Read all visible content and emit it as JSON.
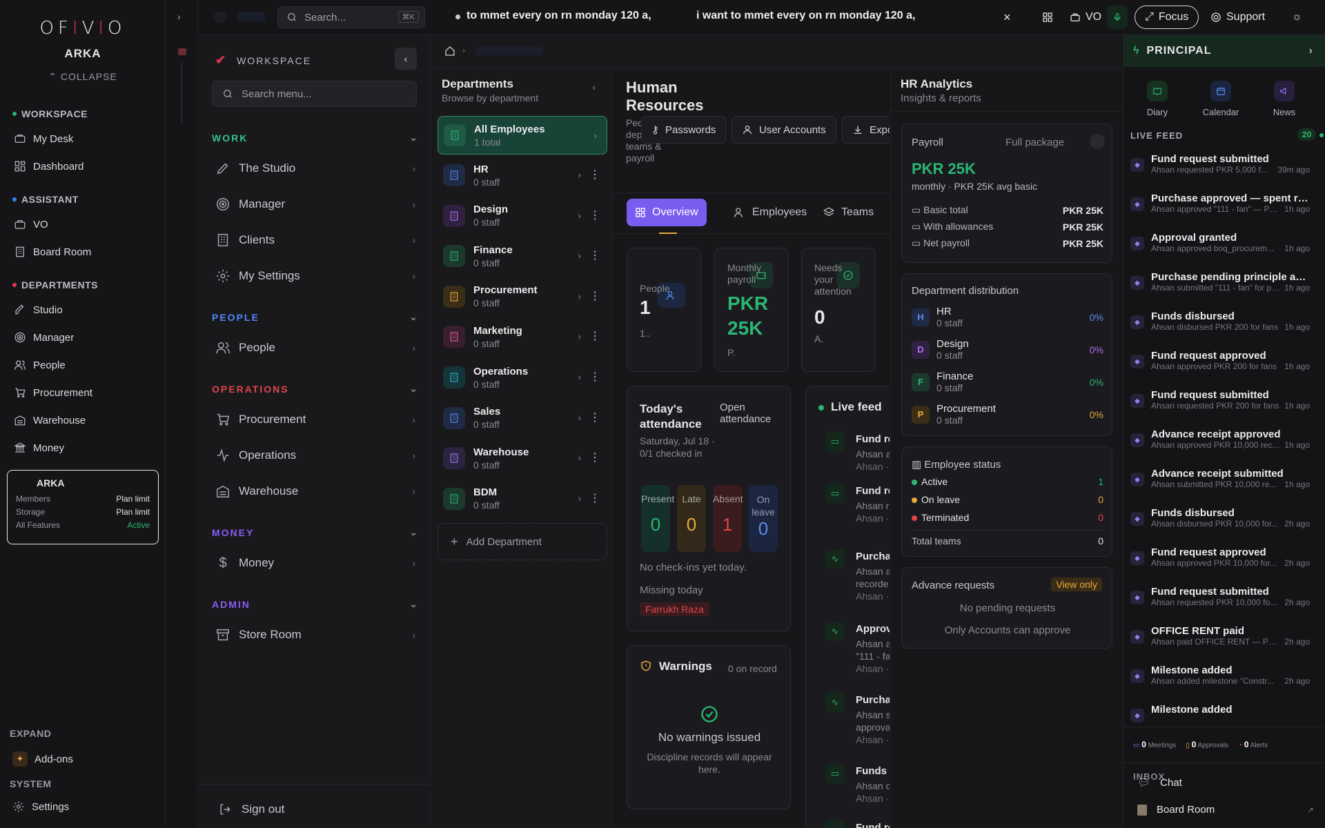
{
  "brand": {
    "logo_text": "OFIVIO",
    "org": "ARKA",
    "collapse_label": "COLLAPSE"
  },
  "leftnav": {
    "sections": [
      {
        "label": "WORKSPACE",
        "color": "#2bb673",
        "items": [
          {
            "label": "My Desk",
            "icon": "desk-icon"
          },
          {
            "label": "Dashboard",
            "icon": "dashboard-icon"
          }
        ]
      },
      {
        "label": "ASSISTANT",
        "color": "#3b82f6",
        "items": [
          {
            "label": "VO",
            "icon": "briefcase-icon"
          },
          {
            "label": "Board Room",
            "icon": "building-icon"
          }
        ]
      },
      {
        "label": "DEPARTMENTS",
        "color": "#e03b4c",
        "items": [
          {
            "label": "Studio",
            "icon": "brush-icon"
          },
          {
            "label": "Manager",
            "icon": "target-icon"
          },
          {
            "label": "People",
            "icon": "people-icon"
          },
          {
            "label": "Procurement",
            "icon": "cart-icon"
          },
          {
            "label": "Warehouse",
            "icon": "warehouse-icon"
          },
          {
            "label": "Money",
            "icon": "money-icon"
          }
        ]
      }
    ],
    "plan": {
      "name": "ARKA",
      "rows": [
        {
          "k": "Members",
          "v": "Plan limit"
        },
        {
          "k": "Storage",
          "v": "Plan limit"
        },
        {
          "k": "All Features",
          "v": "Active"
        }
      ]
    },
    "expand_label": "EXPAND",
    "addons_label": "Add-ons",
    "system_label": "SYSTEM",
    "settings_label": "Settings"
  },
  "topbar": {
    "search_placeholder": "Search...",
    "shortcut": "⌘K",
    "marquee_1": "to mmet every on rn monday 120 a,",
    "marquee_2": "i want to mmet every on rn monday 120 a,",
    "vo_label": "VO",
    "focus_label": "Focus",
    "support_label": "Support"
  },
  "subnav": {
    "workspace_label": "WORKSPACE",
    "search_placeholder": "Search menu...",
    "sections": [
      {
        "label": "WORK",
        "color": "#34c38f",
        "items": [
          "The Studio",
          "Manager",
          "Clients",
          "My Settings"
        ]
      },
      {
        "label": "PEOPLE",
        "color": "#4f86f7",
        "items": [
          "People"
        ]
      },
      {
        "label": "OPERATIONS",
        "color": "#e0454a",
        "items": [
          "Procurement",
          "Operations",
          "Warehouse"
        ]
      },
      {
        "label": "MONEY",
        "color": "#8b5cf6",
        "items": [
          "Money"
        ]
      },
      {
        "label": "ADMIN",
        "color": "#8b5cf6",
        "items": [
          "Store Room"
        ]
      }
    ],
    "signout_label": "Sign out"
  },
  "departments": {
    "title": "Departments",
    "subtitle": "Browse by department",
    "items": [
      {
        "name": "All Employees",
        "staff": "1 total",
        "color": "#2bb673",
        "bg": "#1f5a47"
      },
      {
        "name": "HR",
        "staff": "0 staff",
        "color": "#5b8def",
        "bg": "#1f2a44"
      },
      {
        "name": "Design",
        "staff": "0 staff",
        "color": "#b56cf0",
        "bg": "#2e2240"
      },
      {
        "name": "Finance",
        "staff": "0 staff",
        "color": "#2bb673",
        "bg": "#1b3a2d"
      },
      {
        "name": "Procurement",
        "staff": "0 staff",
        "color": "#e6a93a",
        "bg": "#3b2e17"
      },
      {
        "name": "Marketing",
        "staff": "0 staff",
        "color": "#e0609a",
        "bg": "#3a1f2e"
      },
      {
        "name": "Operations",
        "staff": "0 staff",
        "color": "#35b6c8",
        "bg": "#15353a"
      },
      {
        "name": "Sales",
        "staff": "0 staff",
        "color": "#5b8def",
        "bg": "#1f2a44"
      },
      {
        "name": "Warehouse",
        "staff": "0 staff",
        "color": "#9b7cf0",
        "bg": "#2a2440"
      },
      {
        "name": "BDM",
        "staff": "0 staff",
        "color": "#2bb673",
        "bg": "#1b3a2d"
      }
    ],
    "add_label": "Add Department"
  },
  "hr": {
    "title": "Human Resources",
    "description": "People, departments, teams & payroll",
    "buttons": {
      "passwords": "Passwords",
      "user_accounts": "User Accounts",
      "export": "Expo"
    },
    "tabs": [
      "Overview",
      "Employees",
      "Teams"
    ],
    "stats": [
      {
        "label": "People",
        "value": "1",
        "sub": "1.."
      },
      {
        "label": "Monthly payroll",
        "value": "PKR 25K",
        "sub": "P."
      },
      {
        "label": "Needs your attention",
        "value": "0",
        "sub": "A."
      }
    ],
    "attendance": {
      "title": "Today's attendance",
      "link": "Open attendance",
      "date": "Saturday, Jul 18 · 0/1 checked in",
      "boxes": [
        {
          "label": "Present",
          "value": "0"
        },
        {
          "label": "Late",
          "value": "0"
        },
        {
          "label": "Absent",
          "value": "1"
        },
        {
          "label": "On leave",
          "value": "0"
        }
      ],
      "empty": "No check-ins yet today.",
      "missing_label": "Missing today",
      "missing_name": "Farrukh Raza"
    },
    "warnings": {
      "title": "Warnings",
      "count": "0 on record",
      "empty_title": "No warnings issued",
      "empty_sub": "Discipline records will appear here."
    },
    "livefeed": {
      "title": "Live feed",
      "items": [
        {
          "t": "Fund re",
          "a": "Ahsan a",
          "b": "Ahsan ·"
        },
        {
          "t": "Fund re",
          "a": "Ahsan r",
          "b": "Ahsan ·"
        },
        {
          "t": "Purchas",
          "a": "Ahsan a",
          "a2": "recorde",
          "b": "Ahsan ·"
        },
        {
          "t": "Approv",
          "a": "Ahsan a",
          "a2": "\"111 - far",
          "b": "Ahsan ·"
        },
        {
          "t": "Purchas",
          "a": "Ahsan s",
          "a2": "approva",
          "b": "Ahsan ·"
        },
        {
          "t": "Funds d",
          "a": "Ahsan c",
          "b": "Ahsan ·"
        },
        {
          "t": "Fund re"
        }
      ]
    }
  },
  "analytics": {
    "title": "HR Analytics",
    "subtitle": "Insights & reports",
    "payroll": {
      "label": "Payroll",
      "package": "Full package",
      "value": "PKR 25K",
      "sub": "monthly · PKR 25K avg basic",
      "rows": [
        {
          "k": "Basic total",
          "v": "PKR 25K"
        },
        {
          "k": "With allowances",
          "v": "PKR 25K"
        },
        {
          "k": "Net payroll",
          "v": "PKR 25K"
        }
      ]
    },
    "distribution": {
      "title": "Department distribution",
      "items": [
        {
          "letter": "H",
          "name": "HR",
          "staff": "0 staff",
          "pct": "0%",
          "color": "#5b8def",
          "bg": "#1f2a44"
        },
        {
          "letter": "D",
          "name": "Design",
          "staff": "0 staff",
          "pct": "0%",
          "color": "#b56cf0",
          "bg": "#2e2240"
        },
        {
          "letter": "F",
          "name": "Finance",
          "staff": "0 staff",
          "pct": "0%",
          "color": "#2bb673",
          "bg": "#1b3a2d"
        },
        {
          "letter": "P",
          "name": "Procurement",
          "staff": "0 staff",
          "pct": "0%",
          "color": "#e6a93a",
          "bg": "#3b2e17"
        }
      ]
    },
    "status": {
      "title": "Employee status",
      "items": [
        {
          "k": "Active",
          "v": "1",
          "color": "#2bb673"
        },
        {
          "k": "On leave",
          "v": "0",
          "color": "#e6a93a"
        },
        {
          "k": "Terminated",
          "v": "0",
          "color": "#e0454a"
        }
      ],
      "total_label": "Total teams",
      "total_value": "0"
    },
    "advance": {
      "title": "Advance requests",
      "badge": "View only",
      "empty": "No pending requests",
      "note": "Only Accounts can approve"
    }
  },
  "principal": {
    "title": "PRINCIPAL",
    "quick": [
      {
        "label": "Diary",
        "color": "#2bb673"
      },
      {
        "label": "Calendar",
        "color": "#5b8def"
      },
      {
        "label": "News",
        "color": "#9b7cf0"
      }
    ],
    "livefeed_label": "LIVE FEED",
    "livefeed_count": "20",
    "feed": [
      {
        "t": "Fund request submitted",
        "s": "Ahsan requested PKR 5,000 f...",
        "time": "39m ago"
      },
      {
        "t": "Purchase approved — spent rec...",
        "s": "Ahsan approved \"111 - fan\" — PKR ...",
        "time": "1h ago"
      },
      {
        "t": "Approval granted",
        "s": "Ahsan approved boq_procurem...",
        "time": "1h ago"
      },
      {
        "t": "Purchase pending principle app...",
        "s": "Ahsan submitted \"111 - fan\" for pri...",
        "time": "1h ago"
      },
      {
        "t": "Funds disbursed",
        "s": "Ahsan disbursed PKR 200 for fans",
        "time": "1h ago"
      },
      {
        "t": "Fund request approved",
        "s": "Ahsan approved PKR 200 for fans",
        "time": "1h ago"
      },
      {
        "t": "Fund request submitted",
        "s": "Ahsan requested PKR 200 for fans",
        "time": "1h ago"
      },
      {
        "t": "Advance receipt approved",
        "s": "Ahsan approved PKR 10,000 rec...",
        "time": "1h ago"
      },
      {
        "t": "Advance receipt submitted",
        "s": "Ahsan submitted PKR 10,000 re...",
        "time": "1h ago"
      },
      {
        "t": "Funds disbursed",
        "s": "Ahsan disbursed PKR 10,000 for...",
        "time": "2h ago"
      },
      {
        "t": "Fund request approved",
        "s": "Ahsan approved PKR 10,000 for...",
        "time": "2h ago"
      },
      {
        "t": "Fund request submitted",
        "s": "Ahsan requested PKR 10,000 fo...",
        "time": "2h ago"
      },
      {
        "t": "OFFICE RENT paid",
        "s": "Ahsan paid OFFICE RENT — PKR ...",
        "time": "2h ago"
      },
      {
        "t": "Milestone added",
        "s": "Ahsan added milestone \"Constr...",
        "time": "2h ago"
      },
      {
        "t": "Milestone added",
        "s": "",
        "time": ""
      }
    ],
    "counters": [
      {
        "v": "0",
        "k": "Meetings"
      },
      {
        "v": "0",
        "k": "Approvals"
      },
      {
        "v": "0",
        "k": "Alerts"
      }
    ],
    "inbox_label": "INBOX",
    "inbox": [
      {
        "label": "Chat"
      },
      {
        "label": "Board Room"
      }
    ]
  }
}
